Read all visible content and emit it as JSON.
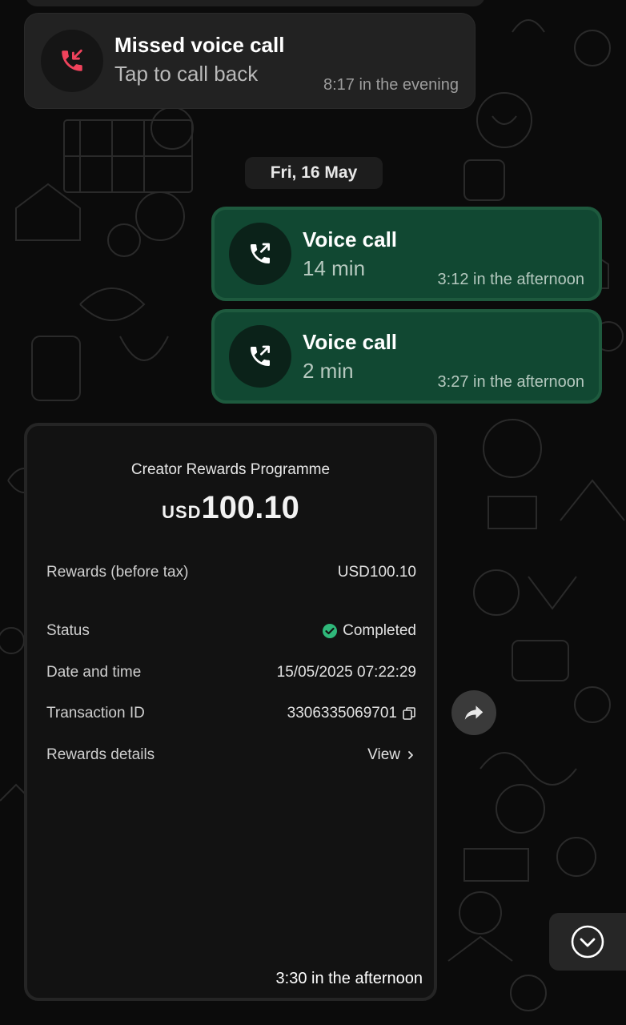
{
  "messages": {
    "missed_call": {
      "title": "Missed voice call",
      "subtitle": "Tap to call back",
      "time": "8:17 in the evening",
      "icon": "missed-call-icon",
      "icon_color": "#f0435c"
    },
    "date_separator": "Fri, 16 May",
    "voice_call_1": {
      "title": "Voice call",
      "duration": "14 min",
      "time": "3:12 in the afternoon",
      "icon": "outgoing-call-icon"
    },
    "voice_call_2": {
      "title": "Voice call",
      "duration": "2 min",
      "time": "3:27 in the afternoon",
      "icon": "outgoing-call-icon"
    },
    "receipt_image": {
      "title": "Creator Rewards Programme",
      "currency": "USD",
      "amount": "100.10",
      "rows": [
        {
          "label": "Rewards (before tax)",
          "value": "USD100.10"
        },
        {
          "label": "Status",
          "value": "Completed",
          "icon": "check-circle-icon",
          "icon_color": "#2fb87a"
        },
        {
          "label": "Date and time",
          "value": "15/05/2025 07:22:29"
        },
        {
          "label": "Transaction ID",
          "value": "3306335069701",
          "icon": "copy-icon"
        },
        {
          "label": "Rewards details",
          "value": "View",
          "icon": "chevron-right-icon"
        }
      ],
      "time": "3:30 in the afternoon"
    }
  },
  "controls": {
    "forward_icon": "forward-icon",
    "scroll_down_icon": "chevron-down-circle-icon"
  },
  "colors": {
    "background": "#0b0b0b",
    "incoming_bubble": "#222222",
    "outgoing_bubble": "#114832"
  }
}
